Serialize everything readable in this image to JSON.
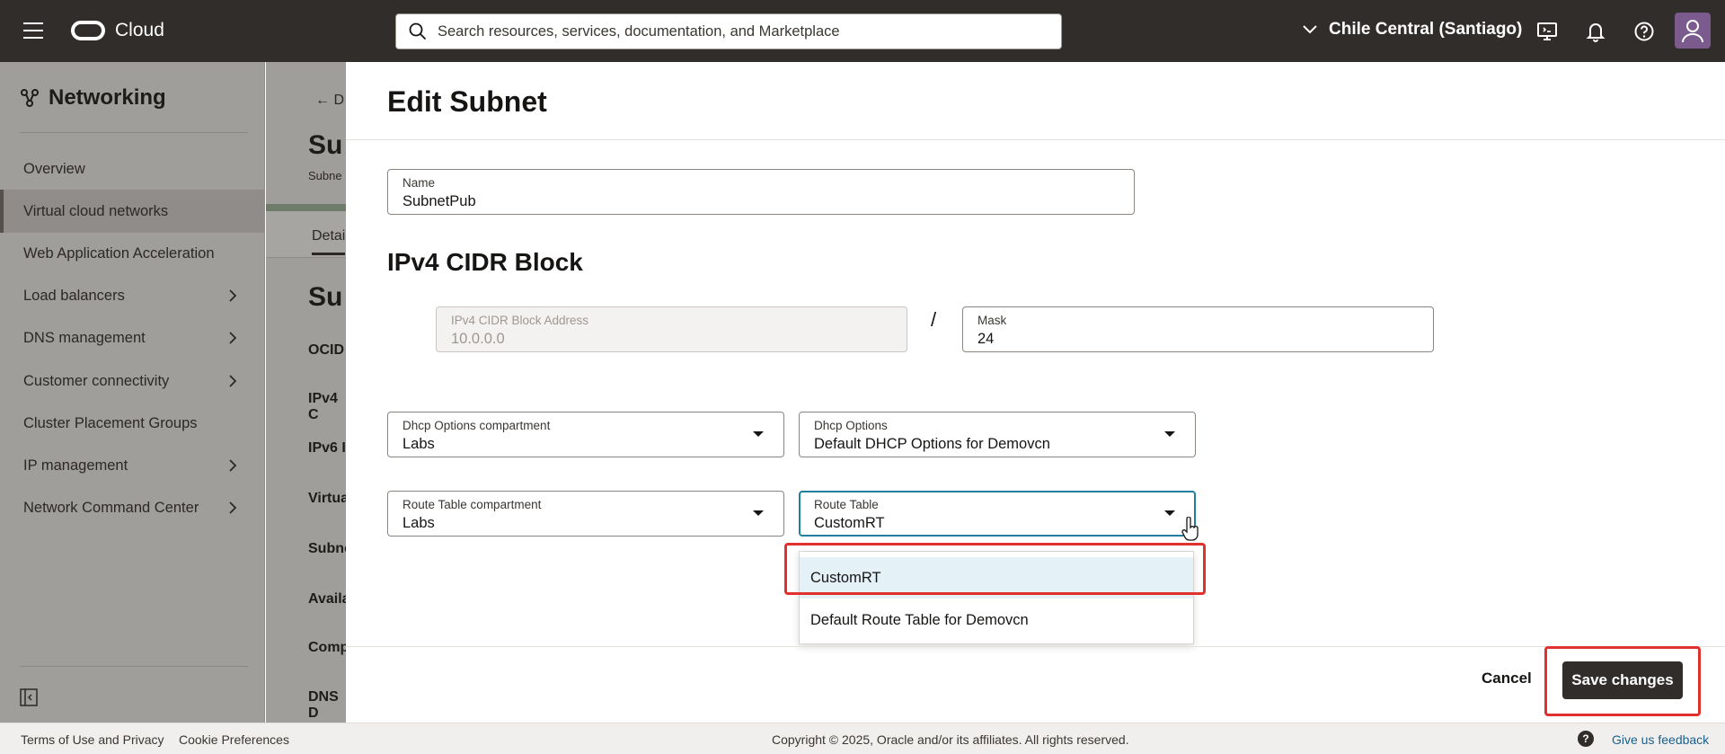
{
  "topbar": {
    "logo_text": "Cloud",
    "search_placeholder": "Search resources, services, documentation, and Marketplace",
    "region": "Chile Central (Santiago)",
    "icons": [
      "menu-icon",
      "search-icon",
      "chevron-down-icon",
      "cloud-shell-icon",
      "bell-icon",
      "help-icon",
      "user-avatar-icon"
    ]
  },
  "sidebar": {
    "title": "Networking",
    "items": [
      {
        "label": "Overview",
        "has_submenu": false
      },
      {
        "label": "Virtual cloud networks",
        "has_submenu": false,
        "active": true
      },
      {
        "label": "Web Application Acceleration",
        "has_submenu": false
      },
      {
        "label": "Load balancers",
        "has_submenu": true
      },
      {
        "label": "DNS management",
        "has_submenu": true
      },
      {
        "label": "Customer connectivity",
        "has_submenu": true
      },
      {
        "label": "Cluster Placement Groups",
        "has_submenu": false
      },
      {
        "label": "IP management",
        "has_submenu": true
      },
      {
        "label": "Network Command Center",
        "has_submenu": true
      }
    ]
  },
  "background_page": {
    "back_text": "D",
    "title": "Su",
    "subtitle": "Subne",
    "tab": "Detai",
    "section_title": "Su",
    "rows": [
      "OCID",
      "IPv4 C",
      "IPv6 I",
      "Virtua",
      "Subne",
      "Availa",
      "Comp",
      "DNS D"
    ]
  },
  "panel": {
    "title": "Edit Subnet",
    "name_field": {
      "label": "Name",
      "value": "SubnetPub"
    },
    "cidr_section": "IPv4 CIDR Block",
    "cidr_address": {
      "label": "IPv4 CIDR Block Address",
      "value": "10.0.0.0"
    },
    "slash": "/",
    "mask": {
      "label": "Mask",
      "value": "24"
    },
    "dhcp_compartment": {
      "label": "Dhcp Options compartment",
      "value": "Labs"
    },
    "dhcp_options": {
      "label": "Dhcp Options",
      "value": "Default DHCP Options for Demovcn"
    },
    "route_compartment": {
      "label": "Route Table compartment",
      "value": "Labs"
    },
    "route_table": {
      "label": "Route Table",
      "value": "CustomRT"
    },
    "route_options": [
      "CustomRT",
      "Default Route Table for Demovcn"
    ],
    "cancel": "Cancel",
    "save": "Save changes"
  },
  "footer": {
    "terms": "Terms of Use and Privacy",
    "cookies": "Cookie Preferences",
    "copyright": "Copyright © 2025, Oracle and/or its affiliates. All rights reserved.",
    "help_glyph": "?",
    "feedback": "Give us feedback"
  },
  "colors": {
    "topbar": "#312d2a",
    "highlight": "#e0312f",
    "focus": "#227e9e",
    "selected_option": "#e4f1f7"
  }
}
